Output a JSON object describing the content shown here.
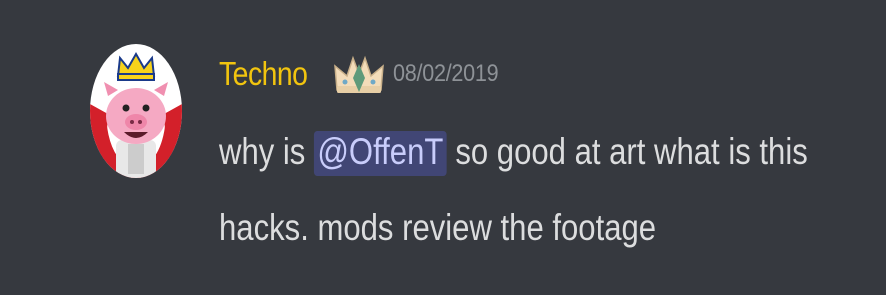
{
  "message": {
    "author": {
      "username": "Techno",
      "username_color": "#f1c40f",
      "avatar_icon": "pig-with-crown-avatar",
      "badge_icon": "crown-badge-icon"
    },
    "timestamp": "08/02/2019",
    "content": {
      "line1_prefix": "why is ",
      "mention": "@OffenT",
      "line1_suffix": " so good at art what is this",
      "line2": "hacks. mods review the footage"
    }
  },
  "colors": {
    "background": "#36393f",
    "text": "#dcddde",
    "timestamp": "#8e9297",
    "mention_bg": "#414675",
    "mention_text": "#c9cdfb"
  }
}
